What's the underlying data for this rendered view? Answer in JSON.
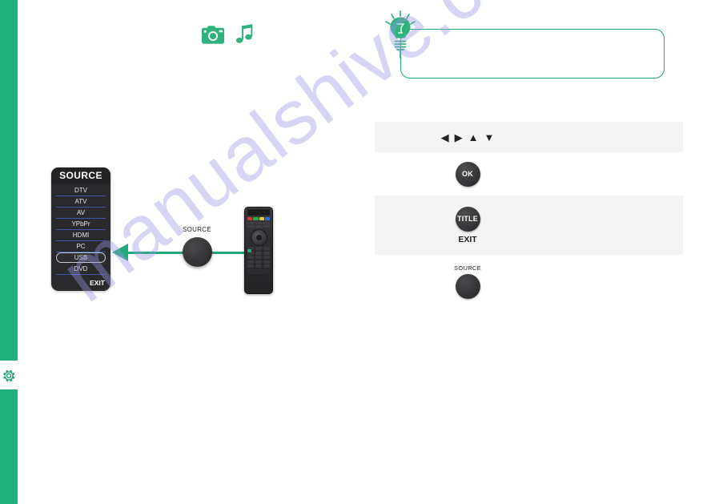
{
  "page": {
    "watermark": "manualshive.com",
    "accent_green": "#22b07d",
    "tip_border_green": "#1aa874",
    "menu_bg": "#2a2a2c",
    "menu_divider_blue": "#3d57a8"
  },
  "sidebar": {
    "gear_icon": "gear-icon"
  },
  "media_icons": {
    "camera": "camera-icon",
    "music": "music-note-icon"
  },
  "source_menu": {
    "title": "SOURCE",
    "items": [
      {
        "label": "DTV",
        "selected": false
      },
      {
        "label": "ATV",
        "selected": false
      },
      {
        "label": "AV",
        "selected": false
      },
      {
        "label": "YPbPr",
        "selected": false
      },
      {
        "label": "HDMI",
        "selected": false
      },
      {
        "label": "PC",
        "selected": false
      },
      {
        "label": "USB",
        "selected": true
      },
      {
        "label": "DVD",
        "selected": false
      }
    ],
    "exit_label": "EXIT"
  },
  "flow": {
    "knob_label": "SOURCE",
    "arrow_icon": "left-arrow-icon",
    "remote_icon": "remote-control-icon"
  },
  "tip": {
    "bulb_icon": "lightbulb-icon",
    "text": ""
  },
  "button_table": {
    "rows": [
      {
        "key_type": "arrows",
        "glyphs": [
          "◀",
          "▶",
          "▲",
          "▼"
        ],
        "icon_names": [
          "left-arrow-icon",
          "right-arrow-icon",
          "up-arrow-icon",
          "down-arrow-icon"
        ],
        "description": ""
      },
      {
        "key_type": "button",
        "label": "OK",
        "sub_label": "",
        "sup_label": "",
        "description": ""
      },
      {
        "key_type": "button",
        "label": "TITLE",
        "sub_label": "EXIT",
        "sup_label": "",
        "description": ""
      },
      {
        "key_type": "button",
        "label": "",
        "sub_label": "",
        "sup_label": "SOURCE",
        "description": ""
      }
    ]
  }
}
